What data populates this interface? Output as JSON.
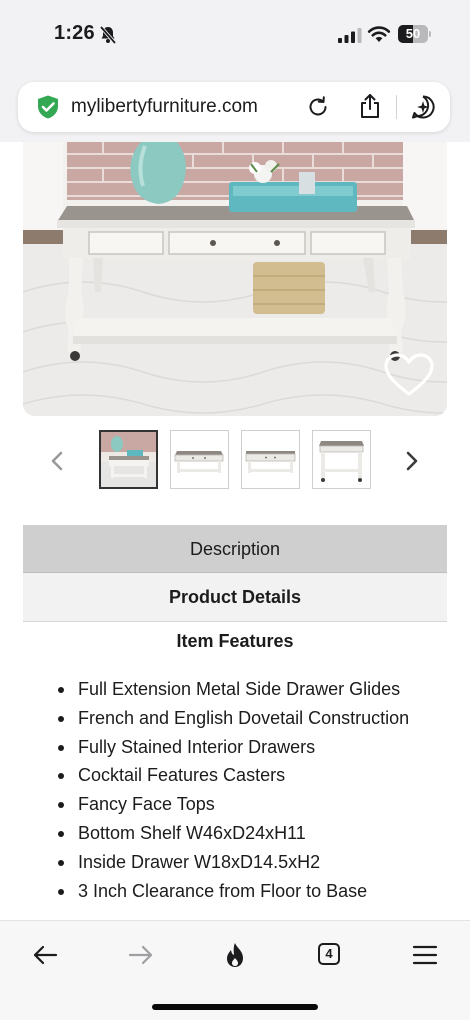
{
  "status_bar": {
    "time": "1:26",
    "battery_level": "50",
    "battery_percent": 50,
    "icons": [
      "bell-slash-icon",
      "cellular-signal-icon",
      "wifi-icon",
      "battery-icon"
    ]
  },
  "browser": {
    "url": "mylibertyfurniture.com",
    "icons": [
      "shield-check-icon",
      "reload-icon",
      "share-icon",
      "ai-sparkle-icon"
    ],
    "tab_count": "4"
  },
  "product": {
    "favorite_icon": "heart-icon",
    "thumbnails_count": 4,
    "active_thumbnail": 1
  },
  "tabs": {
    "description": "Description",
    "product_details": "Product Details"
  },
  "features": {
    "heading": "Item Features",
    "items": [
      "Full Extension Metal Side Drawer Glides",
      "French and English Dovetail Construction",
      "Fully Stained Interior Drawers",
      "Cocktail Features Casters",
      "Fancy Face Tops",
      "Bottom Shelf W46xD24xH11",
      "Inside Drawer W18xD14.5xH2",
      "3 Inch Clearance from Floor to Base"
    ]
  },
  "colors": {
    "chrome_bg": "#f2f2f4",
    "shield_green": "#34a853",
    "tab_active_bg": "#cfcfcf",
    "tab_inactive_bg": "#f2f2f2",
    "text": "#1c1c1e"
  }
}
